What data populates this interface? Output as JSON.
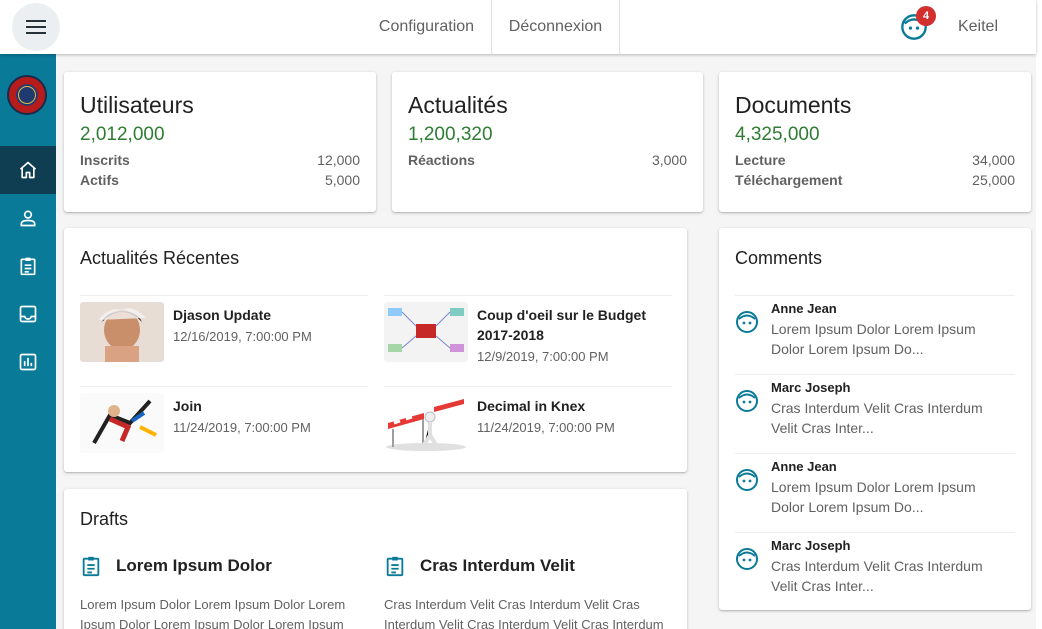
{
  "topbar": {
    "menu_icon": "menu-icon",
    "nav": [
      "Configuration",
      "Déconnexion"
    ],
    "notification_count": "4",
    "user_name": "Keitel"
  },
  "sidebar": {
    "logo": "emblem-logo",
    "items": [
      {
        "icon": "home-icon",
        "active": true
      },
      {
        "icon": "person-icon",
        "active": false
      },
      {
        "icon": "clipboard-icon",
        "active": false
      },
      {
        "icon": "inbox-icon",
        "active": false
      },
      {
        "icon": "bar-chart-icon",
        "active": false
      }
    ]
  },
  "stats": [
    {
      "title": "Utilisateurs",
      "value": "2,012,000",
      "rows": [
        {
          "label": "Inscrits",
          "value": "12,000"
        },
        {
          "label": "Actifs",
          "value": "5,000"
        }
      ]
    },
    {
      "title": "Actualités",
      "value": "1,200,320",
      "rows": [
        {
          "label": "Réactions",
          "value": "3,000"
        }
      ]
    },
    {
      "title": "Documents",
      "value": "4,325,000",
      "rows": [
        {
          "label": "Lecture",
          "value": "34,000"
        },
        {
          "label": "Téléchargement",
          "value": "25,000"
        }
      ]
    }
  ],
  "recent_news": {
    "title": "Actualités Récentes",
    "items": [
      {
        "title": "Djason Update",
        "date": "12/16/2019, 7:00:00 PM"
      },
      {
        "title": "Coup d'oeil sur le Budget 2017-2018",
        "date": "12/9/2019, 7:00:00 PM"
      },
      {
        "title": "Join",
        "date": "11/24/2019, 7:00:00 PM"
      },
      {
        "title": "Decimal in Knex",
        "date": "11/24/2019, 7:00:00 PM"
      }
    ]
  },
  "comments": {
    "title": "Comments",
    "items": [
      {
        "author": "Anne Jean",
        "text": "Lorem Ipsum Dolor Lorem Ipsum Dolor Lorem Ipsum Do..."
      },
      {
        "author": "Marc Joseph",
        "text": "Cras Interdum Velit Cras Interdum Velit Cras Inter..."
      },
      {
        "author": "Anne Jean",
        "text": "Lorem Ipsum Dolor Lorem Ipsum Dolor Lorem Ipsum Do..."
      },
      {
        "author": "Marc Joseph",
        "text": "Cras Interdum Velit Cras Interdum Velit Cras Inter..."
      }
    ]
  },
  "drafts": {
    "title": "Drafts",
    "items": [
      {
        "title": "Lorem Ipsum Dolor",
        "text": "Lorem Ipsum Dolor Lorem Ipsum Dolor Lorem Ipsum Dolor Lorem Ipsum Dolor Lorem Ipsum"
      },
      {
        "title": "Cras Interdum Velit",
        "text": "Cras Interdum Velit Cras Interdum Velit Cras Interdum Velit Cras Interdum Velit Cras Interdum"
      }
    ]
  },
  "colors": {
    "sidebar": "#0a7a99",
    "sidebar_active": "#0f3d52",
    "accent_green": "#2e7d32",
    "icon_teal": "#0a7a99",
    "badge": "#d32f2f"
  }
}
